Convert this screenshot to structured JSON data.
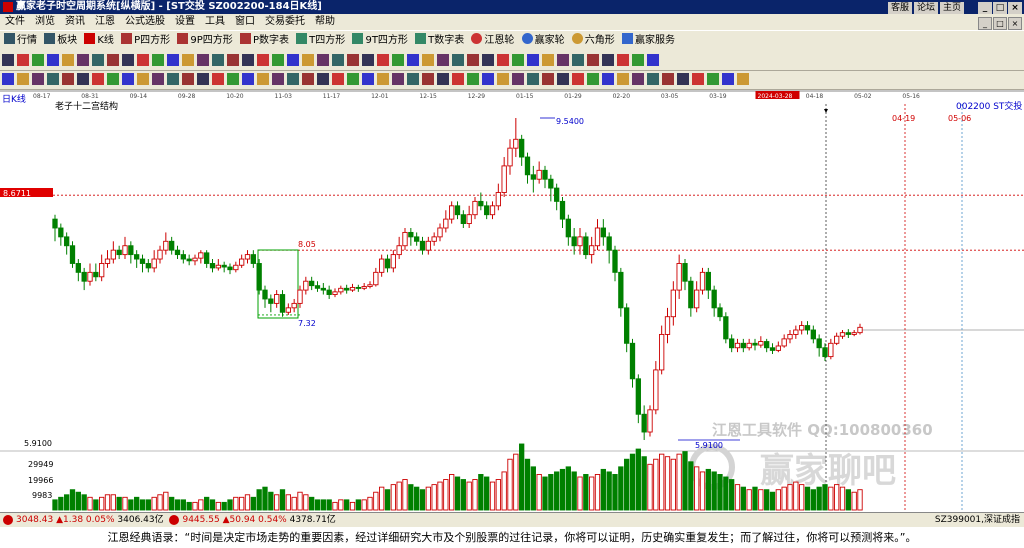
{
  "window": {
    "title": "赢家老子时空周期系统[纵横版] - [ST交投  SZ002200-184日K线]",
    "links": [
      "客服",
      "论坛",
      "主页"
    ],
    "controls": [
      "_",
      "□",
      "×"
    ]
  },
  "menu": [
    "文件",
    "浏览",
    "资讯",
    "江恩",
    "公式选股",
    "设置",
    "工具",
    "窗口",
    "交易委托",
    "帮助"
  ],
  "toolbar": [
    "行情",
    "板块",
    "K线",
    "P四方形",
    "9P四方形",
    "P数字表",
    "T四方形",
    "9T四方形",
    "T数字表",
    "江恩轮",
    "赢家轮",
    "六角形",
    "赢家服务"
  ],
  "chart": {
    "period_label": "日K线",
    "structure_label": "老子十二宫结构",
    "stock": "002200  ST交投",
    "date_axis": [
      "08-17",
      "08-31",
      "09-14",
      "09-28",
      "10-20",
      "11-03",
      "11-17",
      "12-01",
      "12-15",
      "12-29",
      "01-15",
      "01-29",
      "02-20",
      "03-05",
      "03-19",
      "2024-03-28",
      "04-18",
      "05-02",
      "05-16"
    ],
    "future_marks": [
      "04-19",
      "05-06"
    ],
    "price_flag": "8.6711",
    "high_label": "9.5400",
    "low_label": "5.9100",
    "box_top": "8.05",
    "box_bottom": "7.32",
    "min_price_axis": "5.9100",
    "volume_axis": [
      "29949",
      "19966",
      "9983"
    ],
    "watermark1": "江恩工具软件  QQ:100800360",
    "watermark2": "赢家聊吧",
    "colors": {
      "up": "#cc0000",
      "down": "#008000",
      "dash": "#d00000",
      "blue": "#0000cc"
    }
  },
  "chart_data": {
    "type": "candlestick",
    "ylim": [
      5.6,
      10.0
    ],
    "candles": [
      [
        8.4,
        8.3,
        8.45,
        8.15
      ],
      [
        8.3,
        8.2,
        8.35,
        8.1
      ],
      [
        8.2,
        8.1,
        8.25,
        8.0
      ],
      [
        8.1,
        7.9,
        8.15,
        7.85
      ],
      [
        7.9,
        7.8,
        7.95,
        7.7
      ],
      [
        7.8,
        7.7,
        7.85,
        7.6
      ],
      [
        7.7,
        7.8,
        7.9,
        7.65
      ],
      [
        7.8,
        7.75,
        7.9,
        7.7
      ],
      [
        7.75,
        7.9,
        8.0,
        7.7
      ],
      [
        7.9,
        7.95,
        8.05,
        7.85
      ],
      [
        7.95,
        8.05,
        8.15,
        7.9
      ],
      [
        8.05,
        8.0,
        8.1,
        7.95
      ],
      [
        8.0,
        8.1,
        8.2,
        7.95
      ],
      [
        8.1,
        8.0,
        8.15,
        7.9
      ],
      [
        8.0,
        7.95,
        8.05,
        7.85
      ],
      [
        7.95,
        7.9,
        8.0,
        7.8
      ],
      [
        7.9,
        7.85,
        7.95,
        7.8
      ],
      [
        7.85,
        7.95,
        8.05,
        7.8
      ],
      [
        7.95,
        8.05,
        8.1,
        7.9
      ],
      [
        8.05,
        8.15,
        8.25,
        8.0
      ],
      [
        8.15,
        8.05,
        8.2,
        8.0
      ],
      [
        8.05,
        8.0,
        8.1,
        7.95
      ],
      [
        8.0,
        7.95,
        8.05,
        7.9
      ],
      [
        7.95,
        7.93,
        8.0,
        7.88
      ],
      [
        7.93,
        7.96,
        8.0,
        7.88
      ],
      [
        7.96,
        8.02,
        8.05,
        7.9
      ],
      [
        8.02,
        7.9,
        8.05,
        7.85
      ],
      [
        7.9,
        7.85,
        7.95,
        7.8
      ],
      [
        7.85,
        7.88,
        7.95,
        7.82
      ],
      [
        7.88,
        7.86,
        7.92,
        7.8
      ],
      [
        7.86,
        7.83,
        7.9,
        7.78
      ],
      [
        7.83,
        7.88,
        7.92,
        7.8
      ],
      [
        7.88,
        7.95,
        8.0,
        7.85
      ],
      [
        7.95,
        8.0,
        8.05,
        7.9
      ],
      [
        8.0,
        7.9,
        8.05,
        7.85
      ],
      [
        7.9,
        7.6,
        7.95,
        7.55
      ],
      [
        7.6,
        7.5,
        7.65,
        7.4
      ],
      [
        7.5,
        7.45,
        7.55,
        7.35
      ],
      [
        7.45,
        7.55,
        7.6,
        7.4
      ],
      [
        7.55,
        7.35,
        7.6,
        7.3
      ],
      [
        7.35,
        7.4,
        7.45,
        7.32
      ],
      [
        7.4,
        7.45,
        7.5,
        7.35
      ],
      [
        7.45,
        7.6,
        7.65,
        7.4
      ],
      [
        7.6,
        7.7,
        7.75,
        7.55
      ],
      [
        7.7,
        7.65,
        7.75,
        7.6
      ],
      [
        7.65,
        7.62,
        7.7,
        7.58
      ],
      [
        7.62,
        7.6,
        7.68,
        7.55
      ],
      [
        7.6,
        7.55,
        7.65,
        7.5
      ],
      [
        7.55,
        7.58,
        7.62,
        7.52
      ],
      [
        7.58,
        7.62,
        7.65,
        7.55
      ],
      [
        7.62,
        7.6,
        7.66,
        7.56
      ],
      [
        7.6,
        7.63,
        7.67,
        7.58
      ],
      [
        7.63,
        7.62,
        7.66,
        7.58
      ],
      [
        7.62,
        7.64,
        7.68,
        7.6
      ],
      [
        7.64,
        7.66,
        7.7,
        7.62
      ],
      [
        7.66,
        7.8,
        7.85,
        7.64
      ],
      [
        7.8,
        7.95,
        8.0,
        7.75
      ],
      [
        7.95,
        7.85,
        8.0,
        7.8
      ],
      [
        7.85,
        8.0,
        8.05,
        7.8
      ],
      [
        8.0,
        8.1,
        8.2,
        7.95
      ],
      [
        8.1,
        8.25,
        8.3,
        8.05
      ],
      [
        8.25,
        8.2,
        8.3,
        8.1
      ],
      [
        8.2,
        8.15,
        8.25,
        8.1
      ],
      [
        8.15,
        8.05,
        8.2,
        8.0
      ],
      [
        8.05,
        8.15,
        8.2,
        8.0
      ],
      [
        8.15,
        8.2,
        8.25,
        8.1
      ],
      [
        8.2,
        8.3,
        8.35,
        8.15
      ],
      [
        8.3,
        8.4,
        8.5,
        8.25
      ],
      [
        8.4,
        8.55,
        8.6,
        8.35
      ],
      [
        8.55,
        8.45,
        8.6,
        8.4
      ],
      [
        8.45,
        8.35,
        8.5,
        8.3
      ],
      [
        8.35,
        8.45,
        8.55,
        8.3
      ],
      [
        8.45,
        8.6,
        8.65,
        8.4
      ],
      [
        8.6,
        8.55,
        8.7,
        8.5
      ],
      [
        8.55,
        8.45,
        8.6,
        8.4
      ],
      [
        8.45,
        8.55,
        8.6,
        8.4
      ],
      [
        8.55,
        8.7,
        8.8,
        8.5
      ],
      [
        8.7,
        9.0,
        9.1,
        8.65
      ],
      [
        9.0,
        9.2,
        9.3,
        8.9
      ],
      [
        9.2,
        9.3,
        9.54,
        9.1
      ],
      [
        9.3,
        9.1,
        9.35,
        9.0
      ],
      [
        9.1,
        8.9,
        9.15,
        8.8
      ],
      [
        8.9,
        8.85,
        9.0,
        8.7
      ],
      [
        8.85,
        8.95,
        9.05,
        8.8
      ],
      [
        8.95,
        8.85,
        9.0,
        8.75
      ],
      [
        8.85,
        8.75,
        8.9,
        8.6
      ],
      [
        8.75,
        8.6,
        8.8,
        8.5
      ],
      [
        8.6,
        8.4,
        8.65,
        8.3
      ],
      [
        8.4,
        8.2,
        8.45,
        8.1
      ],
      [
        8.2,
        8.1,
        8.3,
        8.0
      ],
      [
        8.1,
        8.2,
        8.3,
        8.0
      ],
      [
        8.2,
        8.0,
        8.25,
        7.95
      ],
      [
        8.0,
        8.1,
        8.2,
        7.9
      ],
      [
        8.1,
        8.3,
        8.4,
        8.05
      ],
      [
        8.3,
        8.2,
        8.4,
        8.1
      ],
      [
        8.2,
        8.05,
        8.25,
        7.9
      ],
      [
        8.05,
        7.8,
        8.1,
        7.7
      ],
      [
        7.8,
        7.4,
        7.85,
        7.3
      ],
      [
        7.4,
        7.0,
        7.45,
        6.9
      ],
      [
        7.0,
        6.6,
        7.05,
        6.5
      ],
      [
        6.6,
        6.2,
        6.65,
        6.1
      ],
      [
        6.2,
        6.0,
        6.3,
        5.91
      ],
      [
        6.0,
        6.25,
        6.3,
        5.95
      ],
      [
        6.25,
        6.7,
        6.8,
        6.2
      ],
      [
        6.7,
        7.1,
        7.2,
        6.65
      ],
      [
        7.1,
        7.3,
        7.4,
        7.0
      ],
      [
        7.3,
        7.6,
        7.7,
        7.2
      ],
      [
        7.6,
        7.9,
        8.0,
        7.5
      ],
      [
        7.9,
        7.7,
        7.95,
        7.6
      ],
      [
        7.7,
        7.4,
        7.75,
        7.3
      ],
      [
        7.4,
        7.6,
        7.7,
        7.35
      ],
      [
        7.6,
        7.8,
        7.85,
        7.55
      ],
      [
        7.8,
        7.6,
        7.85,
        7.5
      ],
      [
        7.6,
        7.4,
        7.65,
        7.3
      ],
      [
        7.4,
        7.3,
        7.45,
        7.25
      ],
      [
        7.3,
        7.05,
        7.35,
        7.0
      ],
      [
        7.05,
        6.95,
        7.1,
        6.9
      ],
      [
        6.95,
        7.0,
        7.05,
        6.9
      ],
      [
        7.0,
        6.95,
        7.05,
        6.9
      ],
      [
        6.95,
        7.0,
        7.05,
        6.92
      ],
      [
        7.0,
        6.98,
        7.05,
        6.92
      ],
      [
        6.98,
        7.02,
        7.08,
        6.95
      ],
      [
        7.02,
        6.95,
        7.05,
        6.9
      ],
      [
        6.95,
        6.92,
        7.0,
        6.88
      ],
      [
        6.92,
        6.97,
        7.02,
        6.9
      ],
      [
        6.97,
        7.05,
        7.1,
        6.95
      ],
      [
        7.05,
        7.1,
        7.15,
        7.0
      ],
      [
        7.1,
        7.15,
        7.2,
        7.05
      ],
      [
        7.15,
        7.2,
        7.25,
        7.1
      ],
      [
        7.2,
        7.15,
        7.25,
        7.1
      ],
      [
        7.15,
        7.05,
        7.2,
        7.0
      ],
      [
        7.05,
        6.95,
        7.1,
        6.85
      ],
      [
        6.95,
        6.85,
        7.0,
        6.8
      ],
      [
        6.85,
        7.0,
        7.05,
        6.82
      ],
      [
        7.0,
        7.08,
        7.12,
        6.98
      ],
      [
        7.08,
        7.12,
        7.15,
        7.05
      ],
      [
        7.12,
        7.1,
        7.16,
        7.06
      ],
      [
        7.1,
        7.12,
        7.15,
        7.08
      ],
      [
        7.12,
        7.18,
        7.22,
        7.1
      ]
    ],
    "volumes": [
      4,
      5,
      6,
      8,
      7,
      6,
      5,
      4,
      5,
      6,
      6,
      5,
      5,
      4,
      5,
      4,
      4,
      5,
      6,
      7,
      5,
      4,
      4,
      3,
      3,
      4,
      5,
      4,
      3,
      3,
      4,
      5,
      5,
      6,
      5,
      8,
      9,
      7,
      6,
      8,
      6,
      5,
      7,
      6,
      5,
      4,
      4,
      4,
      3,
      4,
      4,
      3,
      4,
      4,
      5,
      7,
      9,
      8,
      10,
      11,
      12,
      10,
      9,
      8,
      9,
      10,
      11,
      12,
      14,
      13,
      12,
      11,
      12,
      14,
      13,
      11,
      12,
      15,
      20,
      22,
      26,
      20,
      17,
      14,
      13,
      14,
      15,
      16,
      17,
      15,
      13,
      14,
      13,
      14,
      16,
      15,
      14,
      17,
      20,
      22,
      24,
      21,
      18,
      20,
      22,
      21,
      20,
      22,
      23,
      19,
      17,
      15,
      16,
      15,
      14,
      13,
      12,
      10,
      9,
      8,
      9,
      8,
      8,
      7,
      8,
      9,
      10,
      11,
      10,
      9,
      8,
      9,
      10,
      9,
      10,
      9,
      8,
      7,
      8,
      9,
      10
    ]
  },
  "status": {
    "sh_index": "3048.43",
    "sh_change": "▲1.38 0.05%",
    "sh_amount": "3406.43亿",
    "sz_index": "9445.55",
    "sz_change": "▲50.94 0.54%",
    "sz_amount": "4378.71亿",
    "right_text": "SZ399001,深证成指"
  },
  "quote": "江恩经典语录：“时间是决定市场走势的重要因素，经过详细研究大市及个别股票的过往记录，你将可以证明，历史确实重复发生；而了解过往，你将可以预测将来。”。"
}
